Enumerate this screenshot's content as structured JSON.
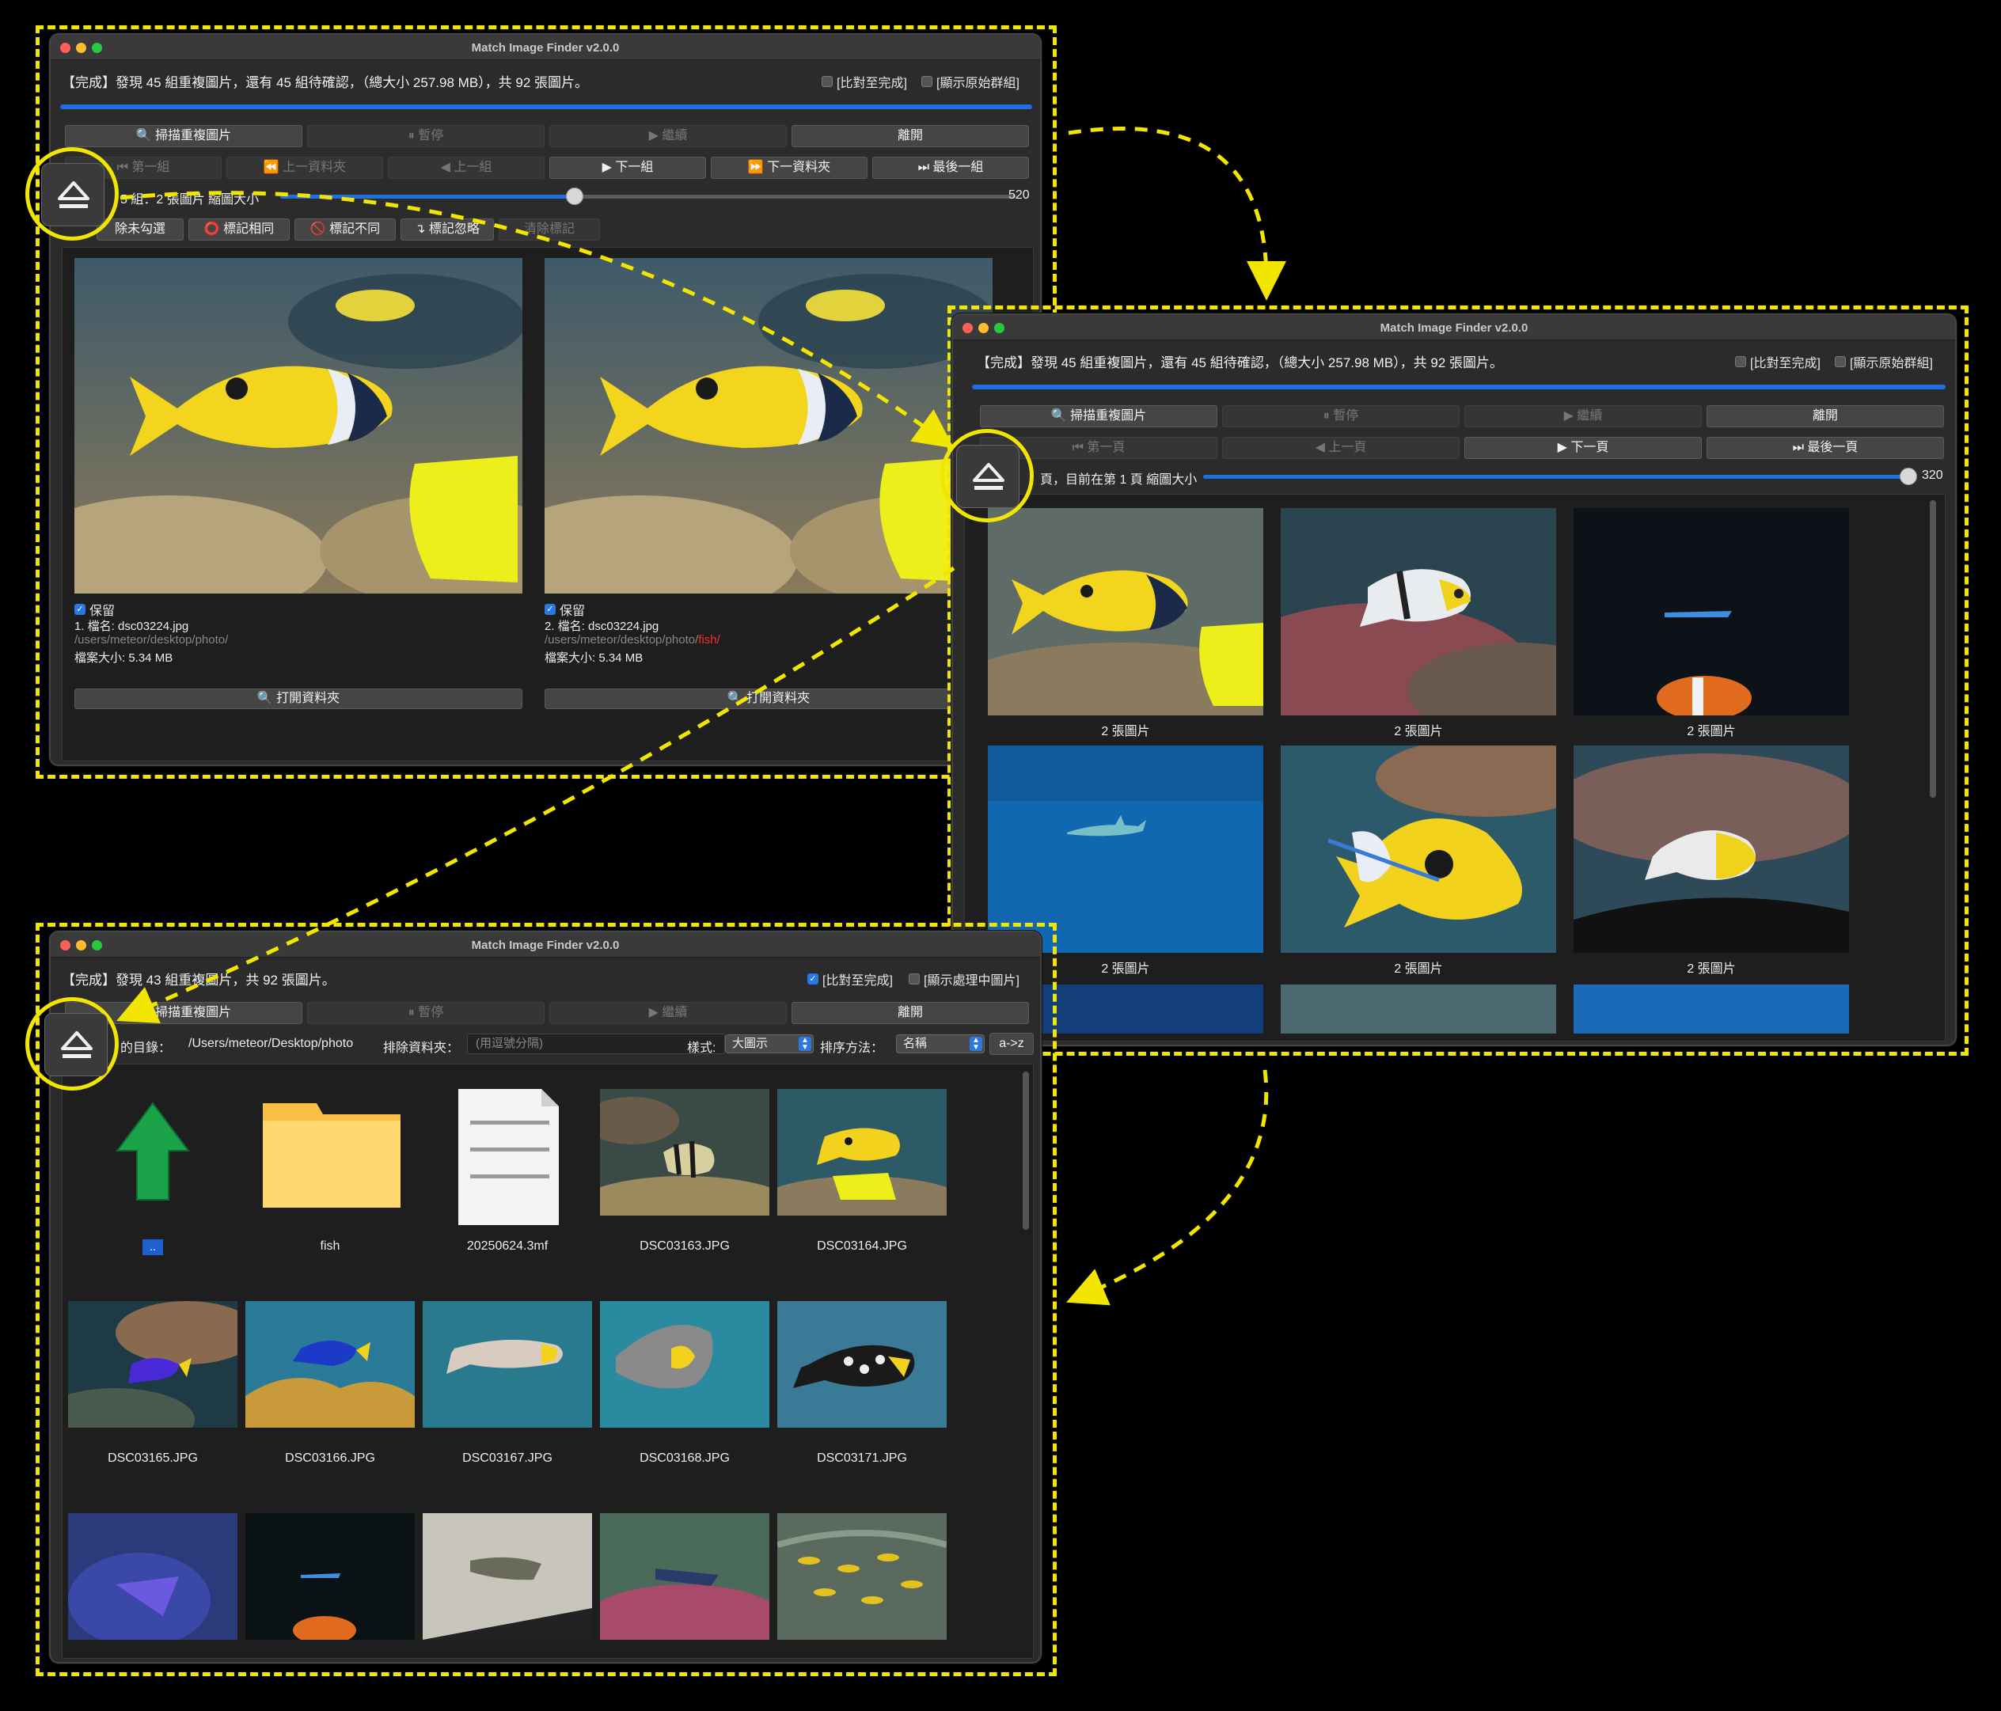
{
  "window_title": "Match Image Finder v2.0.0",
  "win1": {
    "status": "【完成】發現 45 組重複圖片，還有 45 組待確認，（總大小 257.98 MB），共 92 張圖片。",
    "check_compare": "[比對至完成]",
    "check_original": "[顯示原始群組]",
    "btn_scan": "🔍 掃描重複圖片",
    "btn_pause": "⏸ 暫停",
    "btn_continue": "▶ 繼續",
    "btn_exit": "離開",
    "btn_first": "⏮ 第一組",
    "btn_prev_folder": "⏪ 上一資料夾",
    "btn_prev": "◀ 上一組",
    "btn_next": "▶ 下一組",
    "btn_next_folder": "⏩ 下一資料夾",
    "btn_last": "⏭ 最後一組",
    "group_info": "5 組：2 張圖片 縮圖大小",
    "slider_value": "520",
    "slider_fraction": 0.4,
    "btn_clear": "除未勾選",
    "btn_same": "⭕ 標記相同",
    "btn_diff": "🚫 標記不同",
    "btn_ignore": "↴ 標記忽略",
    "btn_clear_marks": "清除標記",
    "left": {
      "keep": "保留",
      "name": "1. 檔名: dsc03224.jpg",
      "path": "/users/meteor/desktop/photo/",
      "size": "檔案大小: 5.34 MB",
      "open": "🔍 打開資料夾"
    },
    "right": {
      "keep": "保留",
      "name": "2. 檔名: dsc03224.jpg",
      "path": "/users/meteor/desktop/photo/",
      "path_extra": "fish/",
      "size": "檔案大小: 5.34 MB",
      "open": "🔍 打開資料夾"
    }
  },
  "win2": {
    "status": "【完成】發現 45 組重複圖片，還有 45 組待確認，（總大小 257.98 MB），共 92 張圖片。",
    "check_compare": "[比對至完成]",
    "check_original": "[顯示原始群組]",
    "btn_scan": "🔍 掃描重複圖片",
    "btn_pause": "⏸ 暫停",
    "btn_continue": "▶ 繼續",
    "btn_exit": "離開",
    "btn_first": "⏮ 第一頁",
    "btn_prev": "◀ 上一頁",
    "btn_next": "▶ 下一頁",
    "btn_last": "⏭ 最後一頁",
    "page_info": "頁，目前在第 1 頁 縮圖大小",
    "slider_value": "320",
    "grid_caption": "2 張圖片"
  },
  "win3": {
    "status": "【完成】發現 43 組重複圖片，共 92 張圖片。",
    "check_compare": "[比對至完成]",
    "check_processing": "[顯示處理中圖片]",
    "btn_scan": "🔍 掃描重複圖片",
    "btn_pause": "⏸ 暫停",
    "btn_continue": "▶ 繼續",
    "btn_exit": "離開",
    "dir_label": "的目錄：",
    "dir_value": "/Users/meteor/Desktop/photo",
    "exclude_label": "排除資料夾：",
    "exclude_placeholder": "(用逗號分隔)",
    "style_label": "樣式:",
    "style_value": "大圖示",
    "sort_label": "排序方法：",
    "sort_value": "名稱",
    "sort_dir": "a->z",
    "files": [
      "..",
      "fish",
      "20250624.3mf",
      "DSC03163.JPG",
      "DSC03164.JPG",
      "DSC03165.JPG",
      "DSC03166.JPG",
      "DSC03167.JPG",
      "DSC03168.JPG",
      "DSC03171.JPG"
    ]
  },
  "icons": [
    "eject-icon",
    "magnifier-icon",
    "up-arrow-icon",
    "folder-icon",
    "document-icon"
  ]
}
